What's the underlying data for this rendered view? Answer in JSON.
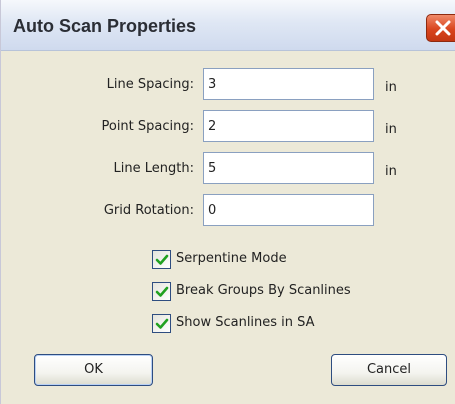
{
  "window": {
    "title": "Auto Scan Properties",
    "close_icon": "close-icon",
    "accent": "#d9461f"
  },
  "fields": [
    {
      "label": "Line Spacing:",
      "value": "3",
      "unit": "in"
    },
    {
      "label": "Point Spacing:",
      "value": "2",
      "unit": "in"
    },
    {
      "label": "Line Length:",
      "value": "5",
      "unit": "in"
    },
    {
      "label": "Grid Rotation:",
      "value": "0",
      "unit": ""
    }
  ],
  "options": [
    {
      "label": "Serpentine Mode",
      "checked": true
    },
    {
      "label": "Break Groups By Scanlines",
      "checked": true
    },
    {
      "label": "Show Scanlines in SA",
      "checked": true
    }
  ],
  "buttons": {
    "ok_label": "OK",
    "cancel_label": "Cancel"
  },
  "colors": {
    "checkmark": "#21a121",
    "dialog_bg": "#ece9d8"
  }
}
